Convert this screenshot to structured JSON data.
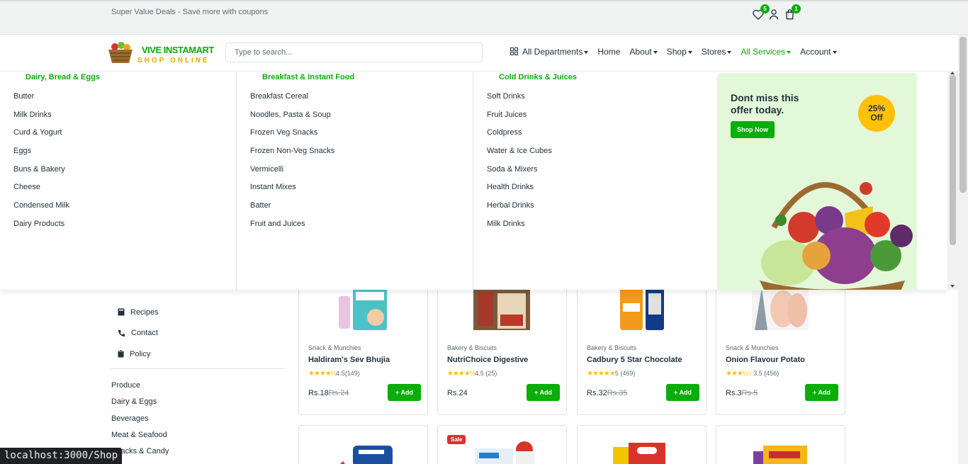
{
  "topbar": {
    "promo": "Super Value Deals - Save more with coupons",
    "wishlist_count": "5",
    "cart_count": "1"
  },
  "logo": {
    "line1": "VIVE INSTAMART",
    "line2": "SHOP ONLINE"
  },
  "search": {
    "placeholder": "Type to search..."
  },
  "nav": {
    "all_departments": "All Departments",
    "home": "Home",
    "about": "About",
    "shop": "Shop",
    "stores": "Stores",
    "all_services": "All Services",
    "account": "Account",
    "active_color": "#0aad0a"
  },
  "mega": {
    "col1": {
      "title": "Dairy, Bread & Eggs",
      "items": [
        "Butter",
        "Milk Drinks",
        "Curd & Yogurt",
        "Eggs",
        "Buns & Bakery",
        "Cheese",
        "Condensed Milk",
        "Dairy Products"
      ]
    },
    "col2": {
      "title": "Breakfast & Instant Food",
      "items": [
        "Breakfast Cereal",
        "Noodles, Pasta & Soup",
        "Frozen Veg Snacks",
        "Frozen Non-Veg Snacks",
        "Vermicelli",
        "Instant Mixes",
        "Batter",
        "Fruit and Juices"
      ]
    },
    "col3": {
      "title": "Cold Drinks & Juices",
      "items": [
        "Soft Drinks",
        "Fruit Juices",
        "Coldpress",
        "Water & Ice Cubes",
        "Soda & Mixers",
        "Health Drinks",
        "Herbal Drinks",
        "Milk Drinks"
      ]
    },
    "promo": {
      "title": "Dont miss this offer today.",
      "button": "Shop Now",
      "discount_value": "25%",
      "discount_label": "Off"
    }
  },
  "sidebar": {
    "links": [
      {
        "label": "Recipes",
        "icon": "book-icon"
      },
      {
        "label": "Contact",
        "icon": "phone-icon"
      },
      {
        "label": "Policy",
        "icon": "clipboard-icon"
      }
    ],
    "categories": [
      "Produce",
      "Dairy & Eggs",
      "Beverages",
      "Meat & Seafood",
      "Snacks & Candy"
    ]
  },
  "products": [
    {
      "category": "Snack & Munchies",
      "name": "Haldiram's Sev Bhujia",
      "stars": "★★★★½",
      "rating": "4.5(149)",
      "price": "Rs.18",
      "old_price": "Rs.24",
      "add": "Add"
    },
    {
      "category": "Bakery & Biscuits",
      "name": "NutriChoice Digestive",
      "stars": "★★★★½",
      "rating": "4.5 (25)",
      "price": "Rs.24",
      "old_price": "",
      "add": "Add"
    },
    {
      "category": "Bakery & Biscuits",
      "name": "Cadbury 5 Star Chocolate",
      "stars": "★★★★★",
      "rating": "5 (469)",
      "price": "Rs.32",
      "old_price": "Rs.35",
      "add": "Add"
    },
    {
      "category": "Snack & Munchies",
      "name": "Onion Flavour Potato",
      "stars": "★★★½☆",
      "rating": "3.5 (456)",
      "price": "Rs.3",
      "old_price": "Rs.5",
      "add": "Add"
    }
  ],
  "row2": {
    "sale_label": "Sale"
  },
  "status_url": "localhost:3000/Shop"
}
